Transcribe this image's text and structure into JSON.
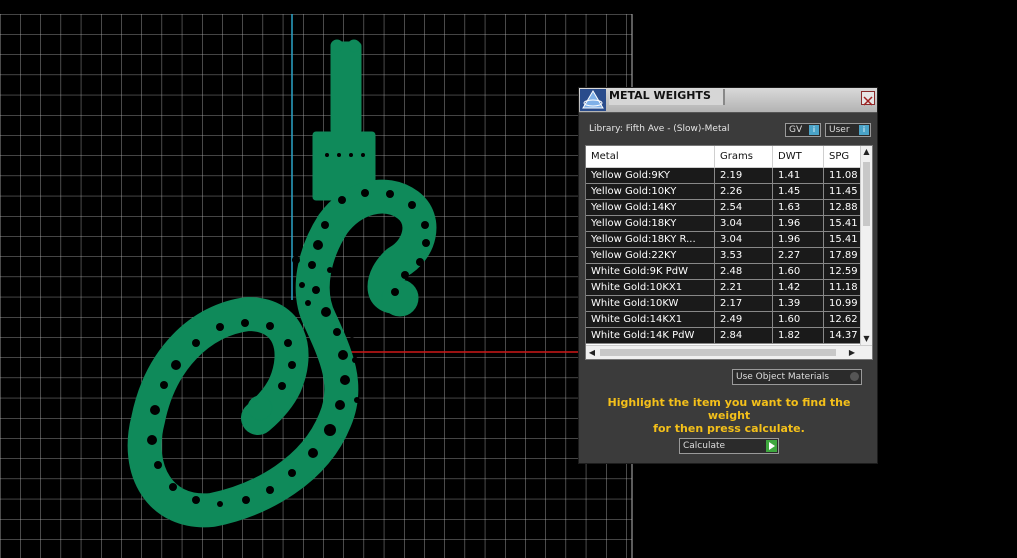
{
  "dialog": {
    "title": "METAL WEIGHTS",
    "library_label": "Library: Fifth Ave - (Slow)-Metal",
    "gv_button": "GV",
    "user_button": "User",
    "columns": [
      "Metal",
      "Grams",
      "DWT",
      "SPG"
    ],
    "rows": [
      [
        "Yellow Gold:9KY",
        "2.19",
        "1.41",
        "11.08"
      ],
      [
        "Yellow Gold:10KY",
        "2.26",
        "1.45",
        "11.45"
      ],
      [
        "Yellow Gold:14KY",
        "2.54",
        "1.63",
        "12.88"
      ],
      [
        "Yellow Gold:18KY",
        "3.04",
        "1.96",
        "15.41"
      ],
      [
        "Yellow Gold:18KY R...",
        "3.04",
        "1.96",
        "15.41"
      ],
      [
        "Yellow Gold:22KY",
        "3.53",
        "2.27",
        "17.89"
      ],
      [
        "White Gold:9K PdW",
        "2.48",
        "1.60",
        "12.59"
      ],
      [
        "White Gold:10KX1",
        "2.21",
        "1.42",
        "11.18"
      ],
      [
        "White Gold:10KW",
        "2.17",
        "1.39",
        "10.99"
      ],
      [
        "White Gold:14KX1",
        "2.49",
        "1.60",
        "12.62"
      ],
      [
        "White Gold:14K PdW",
        "2.84",
        "1.82",
        "14.37"
      ]
    ],
    "use_object_materials": "Use Object Materials",
    "hint_line1": "Highlight the item you want to find the weight",
    "hint_line2": "for then press calculate.",
    "calculate_button": "Calculate"
  },
  "colors": {
    "model": "#0f8a5a",
    "accent_hint": "#f4c01a",
    "grid": "#bdbdbd",
    "axis_x": "#d01818",
    "axis_y": "#2aa4c8"
  }
}
